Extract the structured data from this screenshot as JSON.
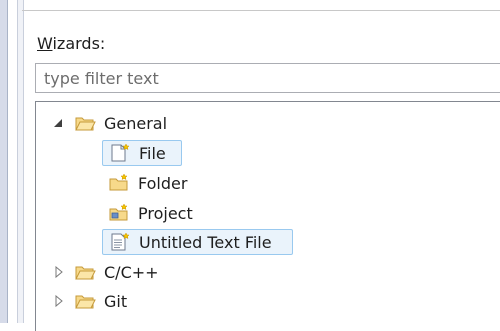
{
  "wizards": {
    "label_prefix": "W",
    "label_rest": "izards:",
    "filter_placeholder": "type filter text"
  },
  "tree": {
    "general": {
      "label": "General",
      "expanded": true
    },
    "children": [
      {
        "label": "File"
      },
      {
        "label": "Folder"
      },
      {
        "label": "Project"
      },
      {
        "label": "Untitled Text File"
      }
    ],
    "cpp": {
      "label": "C/C++",
      "expanded": false
    },
    "git": {
      "label": "Git",
      "expanded": false
    }
  },
  "colors": {
    "selection_border": "#99c9ef",
    "selection_fill": "#eaf3fb",
    "folder": "#f2c76a"
  },
  "icons": {
    "folder": "folder-icon",
    "file": "new-file-icon",
    "new_folder": "new-folder-icon",
    "new_project": "new-project-icon",
    "text_file": "new-text-file-icon"
  }
}
